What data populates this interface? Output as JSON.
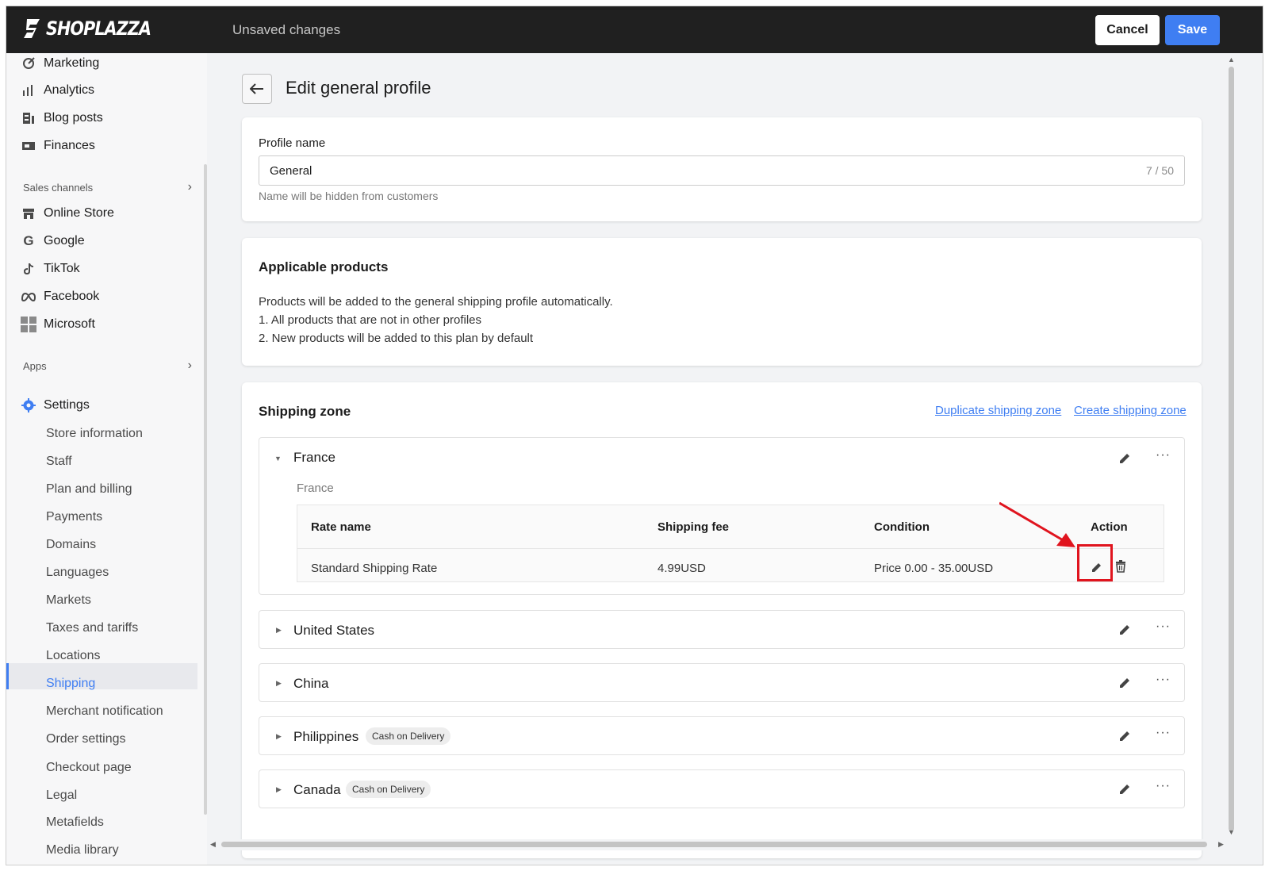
{
  "header": {
    "brand": "SHOPLAZZA",
    "status": "Unsaved changes",
    "cancel_label": "Cancel",
    "save_label": "Save"
  },
  "sidebar": {
    "top_items": [
      {
        "label": "Marketing",
        "icon": "marketing-icon"
      },
      {
        "label": "Analytics",
        "icon": "analytics-icon"
      },
      {
        "label": "Blog posts",
        "icon": "blog-icon"
      },
      {
        "label": "Finances",
        "icon": "finances-icon"
      }
    ],
    "sales_channels_label": "Sales channels",
    "channels": [
      {
        "label": "Online Store",
        "icon": "store-icon"
      },
      {
        "label": "Google",
        "icon": "google-icon"
      },
      {
        "label": "TikTok",
        "icon": "tiktok-icon"
      },
      {
        "label": "Facebook",
        "icon": "meta-icon"
      },
      {
        "label": "Microsoft",
        "icon": "microsoft-icon"
      }
    ],
    "apps_label": "Apps",
    "settings_label": "Settings",
    "settings_items": [
      "Store information",
      "Staff",
      "Plan and billing",
      "Payments",
      "Domains",
      "Languages",
      "Markets",
      "Taxes and tariffs",
      "Locations",
      "Shipping",
      "Merchant notification",
      "Order settings",
      "Checkout page",
      "Legal",
      "Metafields",
      "Media library"
    ],
    "active_item": "Shipping"
  },
  "page": {
    "title": "Edit general profile"
  },
  "profile": {
    "label": "Profile name",
    "value": "General",
    "count": "7 / 50",
    "hint": "Name will be hidden from customers"
  },
  "applicable": {
    "title": "Applicable products",
    "lines": [
      "Products will be added to the general shipping profile automatically.",
      "1. All products that are not in other profiles",
      "2. New products will be added to this plan by default"
    ]
  },
  "shipping_zone": {
    "title": "Shipping zone",
    "duplicate_link": "Duplicate shipping zone",
    "create_link": "Create shipping zone",
    "zones": [
      {
        "name": "France",
        "expanded": true,
        "badge": ""
      },
      {
        "name": "United States",
        "expanded": false,
        "badge": ""
      },
      {
        "name": "China",
        "expanded": false,
        "badge": ""
      },
      {
        "name": "Philippines",
        "expanded": false,
        "badge": "Cash on Delivery"
      },
      {
        "name": "Canada",
        "expanded": false,
        "badge": "Cash on Delivery"
      }
    ],
    "france_detail": {
      "country": "France",
      "headers": {
        "rate_name": "Rate name",
        "fee": "Shipping fee",
        "condition": "Condition",
        "action": "Action"
      },
      "row": {
        "rate_name": "Standard Shipping Rate",
        "fee": "4.99USD",
        "condition": "Price 0.00 - 35.00USD"
      }
    }
  },
  "colors": {
    "accent": "#3f7ef2",
    "topbar": "#202020",
    "highlight": "#e0141e"
  }
}
